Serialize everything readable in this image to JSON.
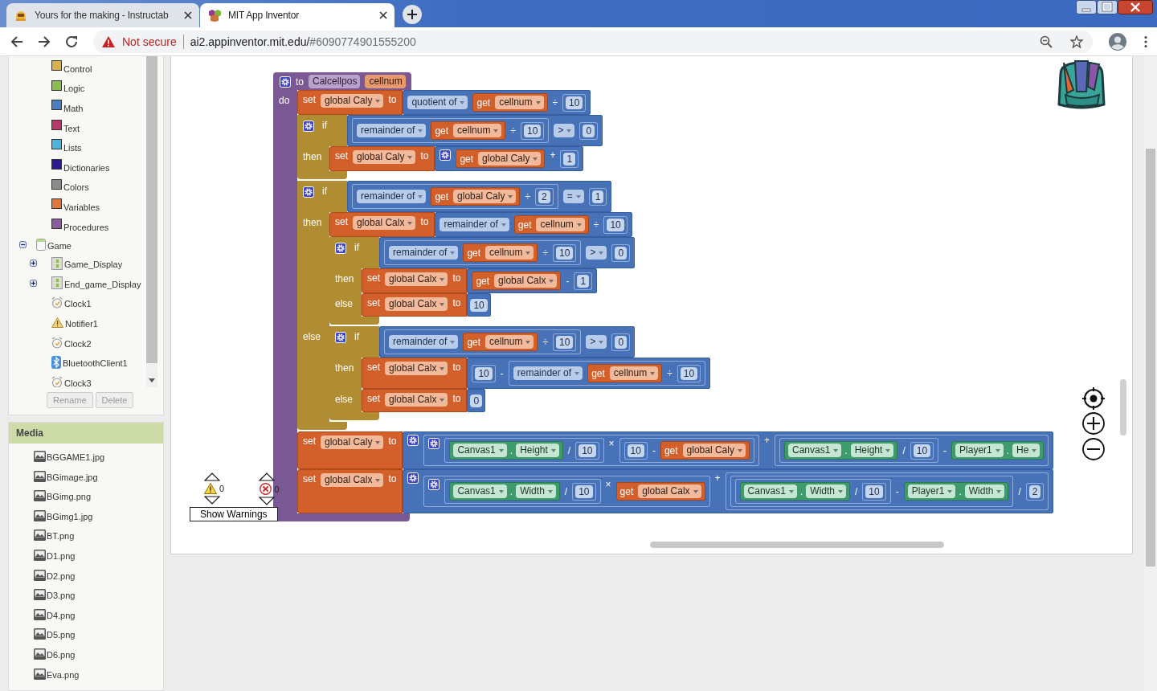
{
  "browser": {
    "tabs": [
      {
        "title": "Yours for the making - Instructab",
        "selected": false,
        "kind": "robot"
      },
      {
        "title": "MIT App Inventor",
        "selected": true,
        "kind": "hexagon"
      }
    ],
    "security": "Not secure",
    "url_host": "ai2.appinventor.mit.edu/",
    "url_rest": "#6090774901555200"
  },
  "blocks_tree": [
    {
      "label": "Control",
      "kind": "category",
      "color": "#d8b14a"
    },
    {
      "label": "Logic",
      "kind": "category",
      "color": "#8cbb4e"
    },
    {
      "label": "Math",
      "kind": "category",
      "color": "#4a7ec2"
    },
    {
      "label": "Text",
      "kind": "category",
      "color": "#b9386a"
    },
    {
      "label": "Lists",
      "kind": "category",
      "color": "#4cb4dc"
    },
    {
      "label": "Dictionaries",
      "kind": "category",
      "color": "#2d1a92"
    },
    {
      "label": "Colors",
      "kind": "category",
      "color": "#8b8b8b"
    },
    {
      "label": "Variables",
      "kind": "category",
      "color": "#e0763a"
    },
    {
      "label": "Procedures",
      "kind": "category",
      "color": "#8a5c9e"
    },
    {
      "label": "Game",
      "kind": "screen",
      "expanded": true,
      "children": [
        {
          "label": "Game_Display",
          "kind": "arrangement",
          "expanded": false
        },
        {
          "label": "End_game_Display",
          "kind": "arrangement",
          "expanded": false
        },
        {
          "label": "Clock1",
          "kind": "clock"
        },
        {
          "label": "Notifier1",
          "kind": "notifier"
        },
        {
          "label": "Clock2",
          "kind": "clock"
        },
        {
          "label": "BluetoothClient1",
          "kind": "bluetooth"
        },
        {
          "label": "Clock3",
          "kind": "clock"
        }
      ]
    }
  ],
  "tree_buttons": [
    {
      "label": "Rename",
      "disabled": true
    },
    {
      "label": "Delete",
      "disabled": true
    }
  ],
  "media": {
    "title": "Media",
    "items": [
      "BGGAME1.jpg",
      "BGimage.jpg",
      "BGimg.png",
      "BGimg1.jpg",
      "BT.png",
      "D1.png",
      "D2.png",
      "D3.png",
      "D4.png",
      "D5.png",
      "D6.png",
      "Eva.png"
    ]
  },
  "workspace": {
    "procedure": {
      "to_label": "to",
      "name": "Calcellpos",
      "param": "cellnum",
      "do_label": "do",
      "body": [
        {
          "kind": "set",
          "label": "set",
          "var": "global Caly",
          "to_label": "to",
          "value": {
            "kind": "divide",
            "mode": "quotient of",
            "left": {
              "kind": "get",
              "label": "get",
              "var": "cellnum"
            },
            "op": "÷",
            "right": {
              "kind": "number",
              "value": "10"
            }
          }
        },
        {
          "kind": "if",
          "gear": true,
          "if_label": "if",
          "cond": {
            "kind": "compare",
            "left": {
              "kind": "divide",
              "mode": "remainder of",
              "left": {
                "kind": "get",
                "label": "get",
                "var": "cellnum"
              },
              "op": "÷",
              "right": {
                "kind": "number",
                "value": "10"
              }
            },
            "op": ">",
            "right": {
              "kind": "number",
              "value": "0"
            }
          },
          "then_label": "then",
          "then": [
            {
              "kind": "set",
              "label": "set",
              "var": "global Caly",
              "to_label": "to",
              "value": {
                "kind": "arith",
                "gear": true,
                "left": {
                  "kind": "get",
                  "label": "get",
                  "var": "global Caly"
                },
                "op": "+",
                "right": {
                  "kind": "number",
                  "value": "1"
                }
              }
            }
          ]
        },
        {
          "kind": "if",
          "gear": true,
          "if_label": "if",
          "cond": {
            "kind": "compare",
            "left": {
              "kind": "divide",
              "mode": "remainder of",
              "left": {
                "kind": "get",
                "label": "get",
                "var": "global Caly"
              },
              "op": "÷",
              "right": {
                "kind": "number",
                "value": "2"
              }
            },
            "op": "=",
            "right": {
              "kind": "number",
              "value": "1"
            }
          },
          "then_label": "then",
          "then": [
            {
              "kind": "set",
              "label": "set",
              "var": "global Calx",
              "to_label": "to",
              "value": {
                "kind": "divide",
                "mode": "remainder of",
                "left": {
                  "kind": "get",
                  "label": "get",
                  "var": "cellnum"
                },
                "op": "÷",
                "right": {
                  "kind": "number",
                  "value": "10"
                }
              }
            },
            {
              "kind": "if",
              "gear": true,
              "if_label": "if",
              "cond": {
                "kind": "compare",
                "left": {
                  "kind": "divide",
                  "mode": "remainder of",
                  "left": {
                    "kind": "get",
                    "label": "get",
                    "var": "cellnum"
                  },
                  "op": "÷",
                  "right": {
                    "kind": "number",
                    "value": "10"
                  }
                },
                "op": ">",
                "right": {
                  "kind": "number",
                  "value": "0"
                }
              },
              "then_label": "then",
              "then": [
                {
                  "kind": "set",
                  "label": "set",
                  "var": "global Calx",
                  "to_label": "to",
                  "value": {
                    "kind": "arith",
                    "gear": false,
                    "left": {
                      "kind": "get",
                      "label": "get",
                      "var": "global Calx"
                    },
                    "op": "-",
                    "right": {
                      "kind": "number",
                      "value": "1"
                    }
                  }
                }
              ],
              "else_label": "else",
              "else": [
                {
                  "kind": "set",
                  "label": "set",
                  "var": "global Calx",
                  "to_label": "to",
                  "value": {
                    "kind": "number",
                    "value": "10"
                  }
                }
              ]
            }
          ],
          "else_label": "else",
          "else": [
            {
              "kind": "if",
              "gear": true,
              "if_label": "if",
              "cond": {
                "kind": "compare",
                "left": {
                  "kind": "divide",
                  "mode": "remainder of",
                  "left": {
                    "kind": "get",
                    "label": "get",
                    "var": "cellnum"
                  },
                  "op": "÷",
                  "right": {
                    "kind": "number",
                    "value": "10"
                  }
                },
                "op": ">",
                "right": {
                  "kind": "number",
                  "value": "0"
                }
              },
              "then_label": "then",
              "then": [
                {
                  "kind": "set",
                  "label": "set",
                  "var": "global Calx",
                  "to_label": "to",
                  "value": {
                    "kind": "arith",
                    "gear": false,
                    "left": {
                      "kind": "number",
                      "value": "10"
                    },
                    "op": "-",
                    "right": {
                      "kind": "divide",
                      "mode": "remainder of",
                      "left": {
                        "kind": "get",
                        "label": "get",
                        "var": "cellnum"
                      },
                      "op": "÷",
                      "right": {
                        "kind": "number",
                        "value": "10"
                      }
                    }
                  }
                }
              ],
              "else_label": "else",
              "else": [
                {
                  "kind": "set",
                  "label": "set",
                  "var": "global Calx",
                  "to_label": "to",
                  "value": {
                    "kind": "number",
                    "value": "0"
                  }
                }
              ]
            }
          ]
        },
        {
          "kind": "set",
          "label": "set",
          "var": "global Caly",
          "to_label": "to",
          "value": {
            "kind": "arith",
            "gear": true,
            "left": {
              "kind": "arith",
              "gear": true,
              "left": {
                "kind": "arith",
                "gear": false,
                "left": {
                  "kind": "property",
                  "component": "Canvas1",
                  "dot": ".",
                  "property": "Height"
                },
                "op": "/",
                "right": {
                  "kind": "number",
                  "value": "10"
                }
              },
              "op": "×",
              "right": {
                "kind": "arith",
                "gear": false,
                "left": {
                  "kind": "number",
                  "value": "10"
                },
                "op": "-",
                "right": {
                  "kind": "get",
                  "label": "get",
                  "var": "global Caly"
                }
              }
            },
            "op": "+",
            "right": {
              "kind": "arith",
              "gear": false,
              "left": {
                "kind": "arith",
                "gear": false,
                "left": {
                  "kind": "property",
                  "component": "Canvas1",
                  "dot": ".",
                  "property": "Height"
                },
                "op": "/",
                "right": {
                  "kind": "number",
                  "value": "10"
                }
              },
              "op": "-",
              "right": {
                "kind": "property",
                "component": "Player1",
                "dot": ".",
                "property": "He"
              }
            }
          }
        },
        {
          "kind": "set",
          "label": "set",
          "var": "global Calx",
          "to_label": "to",
          "value": {
            "kind": "arith",
            "gear": true,
            "left": {
              "kind": "arith",
              "gear": true,
              "left": {
                "kind": "arith",
                "gear": false,
                "left": {
                  "kind": "property",
                  "component": "Canvas1",
                  "dot": ".",
                  "property": "Width"
                },
                "op": "/",
                "right": {
                  "kind": "number",
                  "value": "10"
                }
              },
              "op": "×",
              "right": {
                "kind": "get",
                "label": "get",
                "var": "global Calx"
              }
            },
            "op": "+",
            "right": {
              "kind": "arith",
              "gear": false,
              "left": {
                "kind": "arith",
                "gear": false,
                "left": {
                  "kind": "arith",
                  "gear": false,
                  "left": {
                    "kind": "property",
                    "component": "Canvas1",
                    "dot": ".",
                    "property": "Width"
                  },
                  "op": "/",
                  "right": {
                    "kind": "number",
                    "value": "10"
                  }
                },
                "op": "-",
                "right": {
                  "kind": "property",
                  "component": "Player1",
                  "dot": ".",
                  "property": "Width"
                }
              },
              "op": "/",
              "right": {
                "kind": "number",
                "value": "2"
              }
            }
          }
        }
      ]
    },
    "warnings": {
      "warning_count": "0",
      "error_count": "0",
      "button": "Show Warnings"
    }
  }
}
